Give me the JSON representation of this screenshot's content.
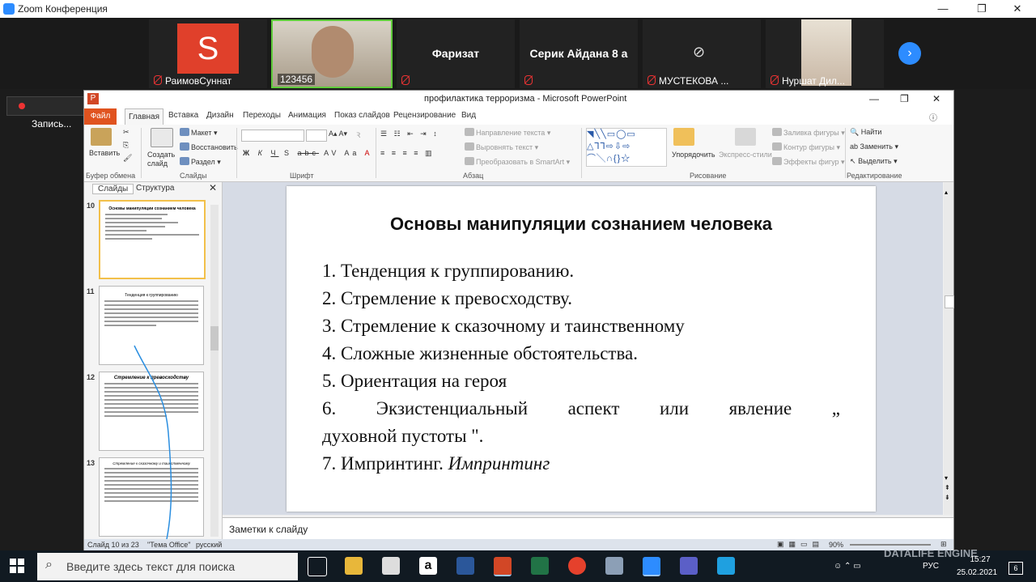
{
  "zoom": {
    "window_title": "Zoom Конференция",
    "participants": [
      {
        "name": "РаимовСуннат",
        "avatar_letter": "S"
      },
      {
        "name": "123456"
      },
      {
        "name": "Фаризат"
      },
      {
        "name": "Серик Айдана 8 а"
      },
      {
        "name": "МУСТЕКОВА ..."
      },
      {
        "name": "Нуршат Дил..."
      }
    ],
    "recording_label": "Запись..."
  },
  "ppt": {
    "window_title": "профилактика терроризма - Microsoft PowerPoint",
    "tabs": [
      "Файл",
      "Главная",
      "Вставка",
      "Дизайн",
      "Переходы",
      "Анимация",
      "Показ слайдов",
      "Рецензирование",
      "Вид"
    ],
    "ribbon": {
      "paste": "Вставить",
      "create_slide": "Создать слайд",
      "layout": "Макет",
      "reset": "Восстановить",
      "section": "Раздел",
      "text_direction": "Направление текста",
      "align_text": "Выровнять текст",
      "smartart": "Преобразовать в SmartArt",
      "arrange": "Упорядочить",
      "quick_styles": "Экспресс-стили",
      "shape_fill": "Заливка фигуры",
      "shape_outline": "Контур фигуры",
      "shape_effects": "Эффекты фигур",
      "find": "Найти",
      "replace": "Заменить",
      "select": "Выделить",
      "groups": [
        "Буфер обмена",
        "Слайды",
        "Шрифт",
        "Абзац",
        "Рисование",
        "Редактирование"
      ],
      "font_buttons": [
        "Ж",
        "К",
        "Ч",
        "S",
        "abc",
        "AV",
        "Aa",
        "A"
      ]
    },
    "panel_tabs": [
      "Слайды",
      "Структура"
    ],
    "thumbnails": [
      {
        "num": "10",
        "title": "Основы манипуляции сознанием человека"
      },
      {
        "num": "11",
        "title": "Тенденция к группированию"
      },
      {
        "num": "12",
        "title": "Стремление к превосходству"
      },
      {
        "num": "13",
        "title": "Стремление к сказочному и таинственному"
      }
    ],
    "slide": {
      "title": "Основы манипуляции сознанием человека",
      "items": [
        "1. Тенденция к группированию.",
        "2.  Стремление к превосходству.",
        "3.  Стремление к сказочному и таинственному",
        "4.  Сложные жизненные обстоятельства.",
        "5.  Ориентация на героя"
      ],
      "item6_words": [
        "6.",
        "Экзистенциальный",
        "аспект",
        "или",
        "явление",
        "„"
      ],
      "item6_cont": "духовной пустоты \".",
      "item7_prefix": "7.    Импринтинг.",
      "item7_italic": "Импринтинг"
    },
    "notes_placeholder": "Заметки к слайду",
    "status": {
      "slide_info": "Слайд 10 из 23",
      "theme": "\"Тема Office\"",
      "language": "русский",
      "zoom": "90%"
    }
  },
  "taskbar": {
    "search_placeholder": "Введите здесь текст для поиска",
    "language": "РУС",
    "time": "15:27",
    "date": "25.02.2021",
    "notifications": "6",
    "watermark": "DATALIFE ENGINE"
  }
}
